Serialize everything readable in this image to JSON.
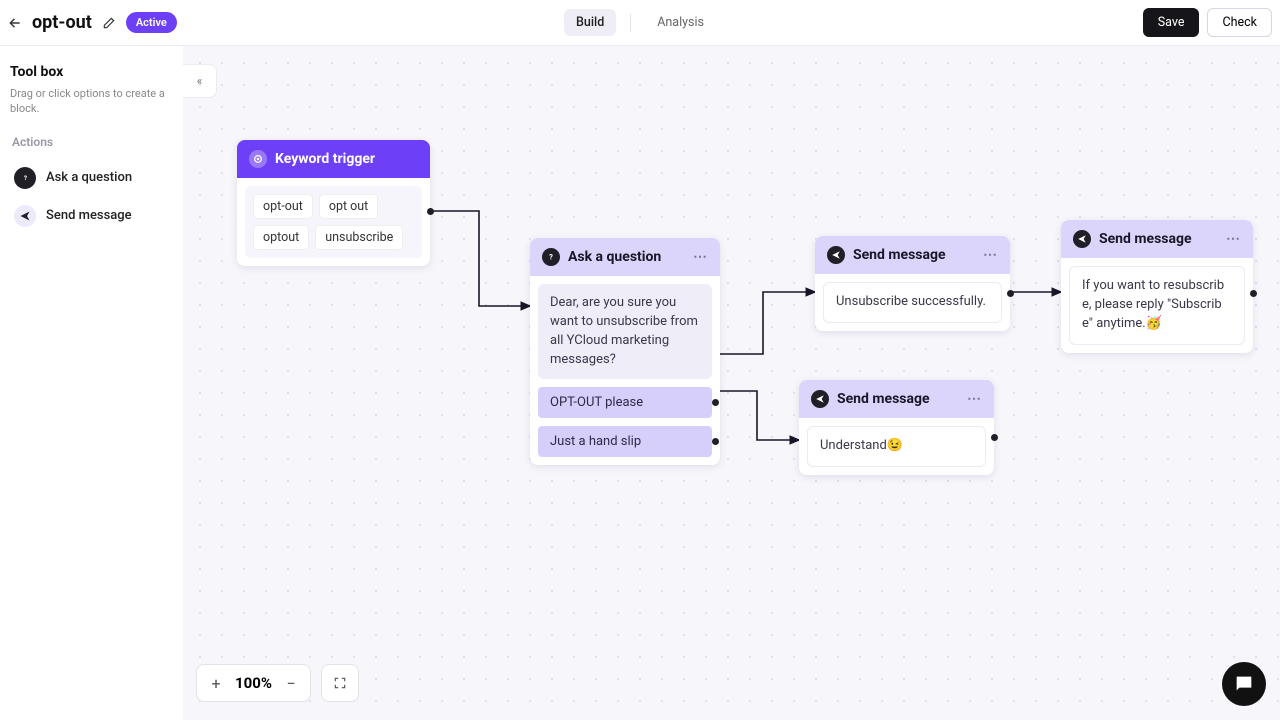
{
  "header": {
    "title": "opt-out",
    "status": "Active",
    "tabs": {
      "build": "Build",
      "analysis": "Analysis"
    },
    "save": "Save",
    "check": "Check"
  },
  "sidebar": {
    "title": "Tool box",
    "desc": "Drag or click options to create a block.",
    "section": "Actions",
    "items": [
      {
        "label": "Ask a question"
      },
      {
        "label": "Send message"
      }
    ],
    "collapse": "«"
  },
  "nodes": {
    "trigger": {
      "title": "Keyword trigger",
      "keywords": [
        "opt-out",
        "opt out",
        "optout",
        "unsubscribe"
      ]
    },
    "ask": {
      "title": "Ask a question",
      "prompt": "Dear, are you sure you want to unsubscribe from all YCloud marketing messages?",
      "options": [
        "OPT-OUT please",
        "Just a hand slip"
      ]
    },
    "send1": {
      "title": "Send message",
      "body": "Unsubscribe successfully."
    },
    "send2": {
      "title": "Send message",
      "body": "Understand😉"
    },
    "send3": {
      "title": "Send message",
      "body": "If you want to resubscribe, please reply \"Subscribe\" anytime.🥳"
    }
  },
  "zoom": {
    "value": "100%"
  }
}
